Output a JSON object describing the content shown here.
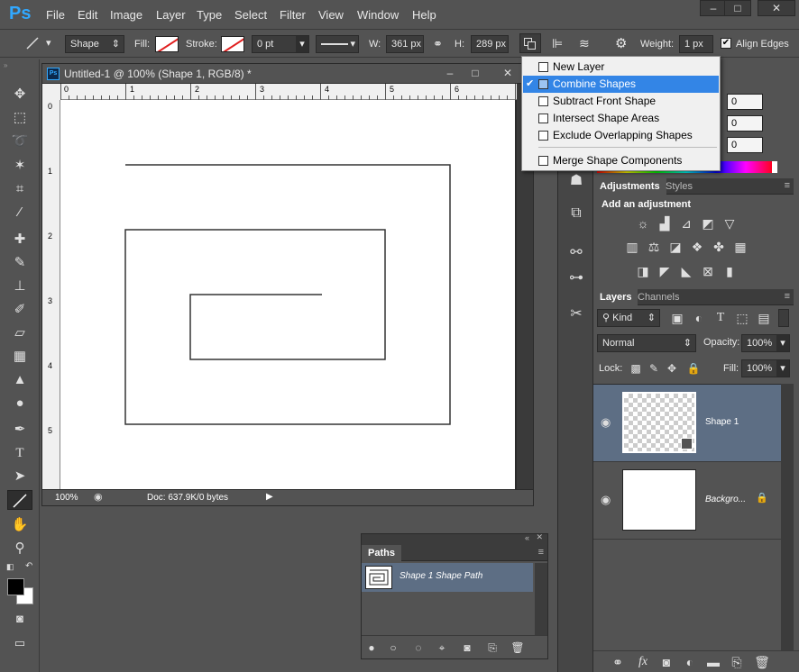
{
  "app": {
    "logo": "Ps"
  },
  "menubar": {
    "items": [
      "File",
      "Edit",
      "Image",
      "Layer",
      "Type",
      "Select",
      "Filter",
      "View",
      "Window",
      "Help"
    ],
    "window_controls": [
      "–",
      "□",
      "✕"
    ]
  },
  "options": {
    "tool_mode": "Shape",
    "fill_label": "Fill:",
    "stroke_label": "Stroke:",
    "stroke_width": "0 pt",
    "w_label": "W:",
    "w_value": "361 px",
    "h_label": "H:",
    "h_value": "289 px",
    "weight_label": "Weight:",
    "weight_value": "1 px",
    "align_edges": "Align Edges",
    "align_edges_checked": true
  },
  "document": {
    "icon": "Ps",
    "title": "Untitled-1 @ 100% (Shape 1, RGB/8) *",
    "zoom": "100%",
    "doc_info": "Doc: 637.9K/0 bytes",
    "ruler_h": [
      "0",
      "1",
      "2",
      "3",
      "4",
      "5",
      "6"
    ],
    "ruler_v": [
      "0",
      "1",
      "2",
      "3",
      "4",
      "5"
    ]
  },
  "path_operations": {
    "items": [
      {
        "label": "New Layer",
        "selected": false
      },
      {
        "label": "Combine Shapes",
        "selected": true
      },
      {
        "label": "Subtract Front Shape",
        "selected": false
      },
      {
        "label": "Intersect Shape Areas",
        "selected": false
      },
      {
        "label": "Exclude Overlapping Shapes",
        "selected": false
      },
      {
        "label": "Merge Shape Components",
        "selected": false
      }
    ],
    "check": "✔"
  },
  "color_panel": {
    "values": [
      "0",
      "0",
      "0"
    ]
  },
  "adjustments": {
    "tabs": [
      "Adjustments",
      "Styles"
    ],
    "heading": "Add an adjustment"
  },
  "layers": {
    "tabs": [
      "Layers",
      "Channels"
    ],
    "kind": "Kind",
    "blend_mode": "Normal",
    "opacity_label": "Opacity:",
    "opacity_value": "100%",
    "lock_label": "Lock:",
    "fill_label": "Fill:",
    "fill_value": "100%",
    "items": [
      {
        "name": "Shape 1",
        "selected": true
      },
      {
        "name": "Backgro...",
        "selected": false,
        "locked": true
      }
    ],
    "footer_icons": [
      "link-icon",
      "fx-icon",
      "mask-icon",
      "adjustment-icon",
      "folder-icon",
      "new-layer-icon",
      "trash-icon"
    ]
  },
  "paths": {
    "tab": "Paths",
    "items": [
      "Shape 1 Shape Path"
    ]
  },
  "colors": {
    "selected_item": "#3385e6",
    "layer_selected": "#5d6e84",
    "path_selected": "#5d6e84",
    "ps_blue": "#31a8ff"
  }
}
